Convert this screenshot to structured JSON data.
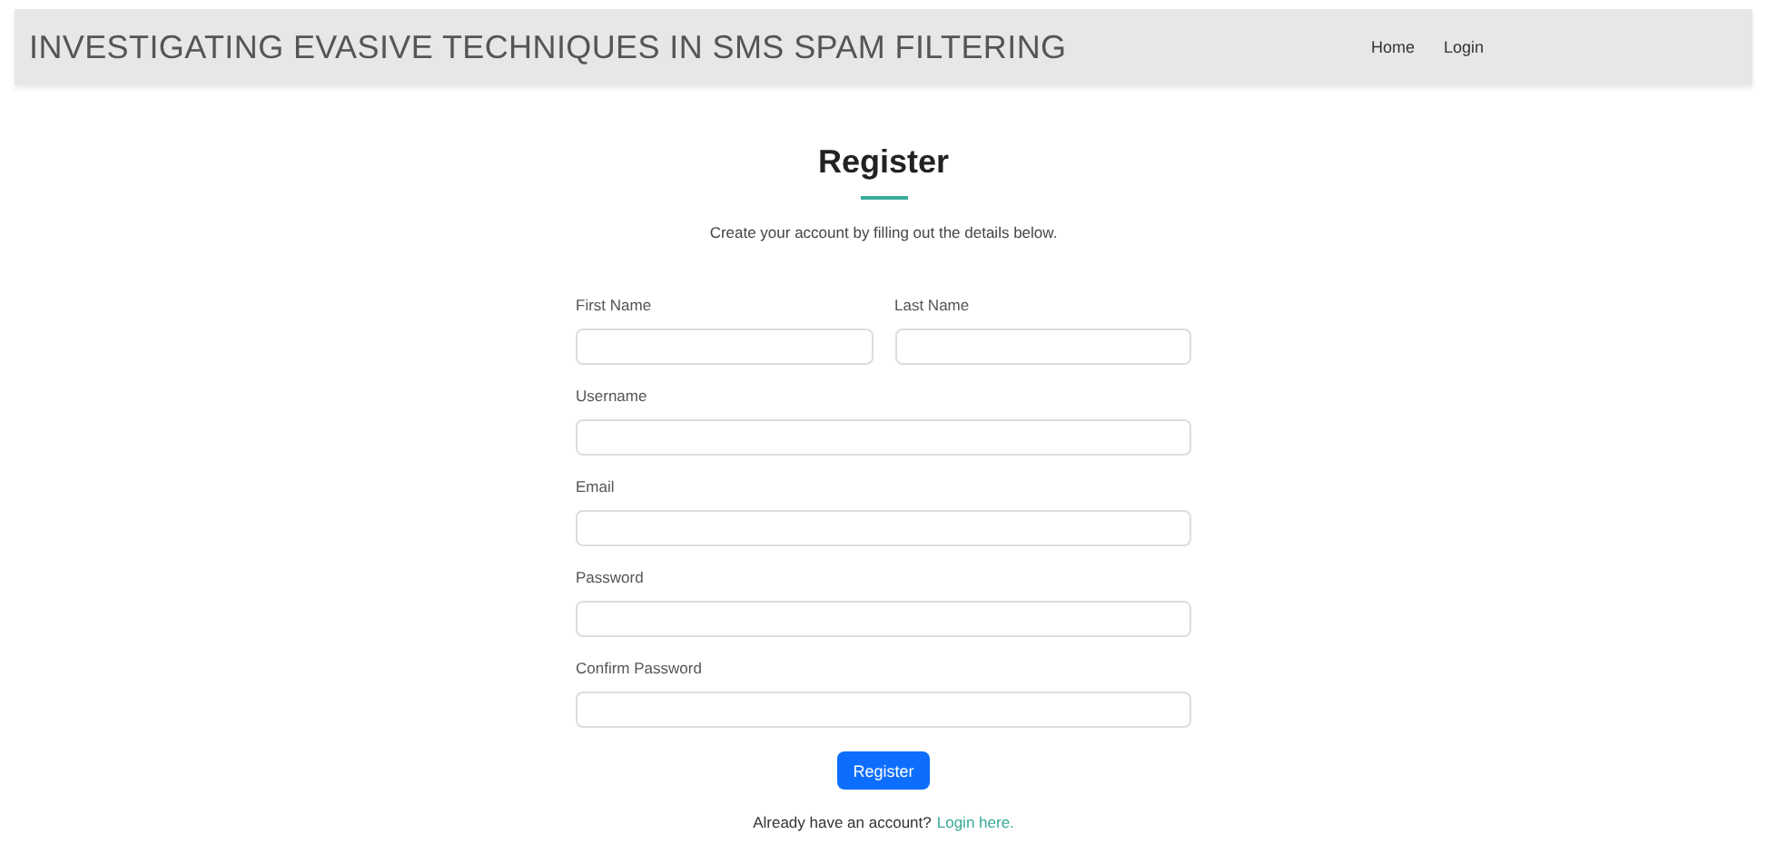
{
  "header": {
    "title": "INVESTIGATING EVASIVE TECHNIQUES IN SMS SPAM FILTERING",
    "nav": [
      "Home",
      "Login"
    ]
  },
  "form": {
    "heading": "Register",
    "subtitle": "Create your account by filling out the details below.",
    "rows": [
      [
        {
          "label": "First Name"
        },
        {
          "label": "Last Name"
        }
      ],
      [
        {
          "label": "Username"
        }
      ],
      [
        {
          "label": "Email"
        }
      ],
      [
        {
          "label": "Password"
        }
      ],
      [
        {
          "label": "Confirm Password"
        }
      ]
    ],
    "button": "Register",
    "footer": {
      "text": "Already have an account?",
      "link": "Login here."
    }
  }
}
